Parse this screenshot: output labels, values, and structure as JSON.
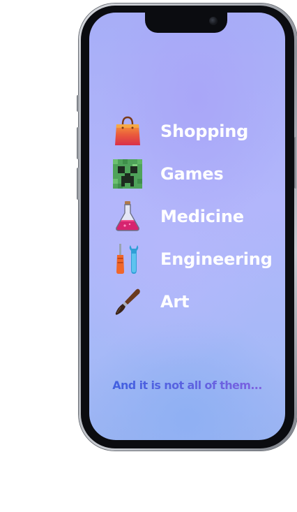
{
  "categories": [
    {
      "label": "Shopping",
      "icon": "shopping-bag-icon"
    },
    {
      "label": "Games",
      "icon": "creeper-icon"
    },
    {
      "label": "Medicine",
      "icon": "flask-icon"
    },
    {
      "label": "Engineering",
      "icon": "tools-icon"
    },
    {
      "label": "Art",
      "icon": "paintbrush-icon"
    }
  ],
  "footnote": "And it is not all of them...",
  "colors": {
    "screen_background": "#b2b6fb",
    "label_text": "#ffffff",
    "footnote_gradient_start": "#3a5fe0",
    "footnote_gradient_end": "#8a5fe0"
  }
}
